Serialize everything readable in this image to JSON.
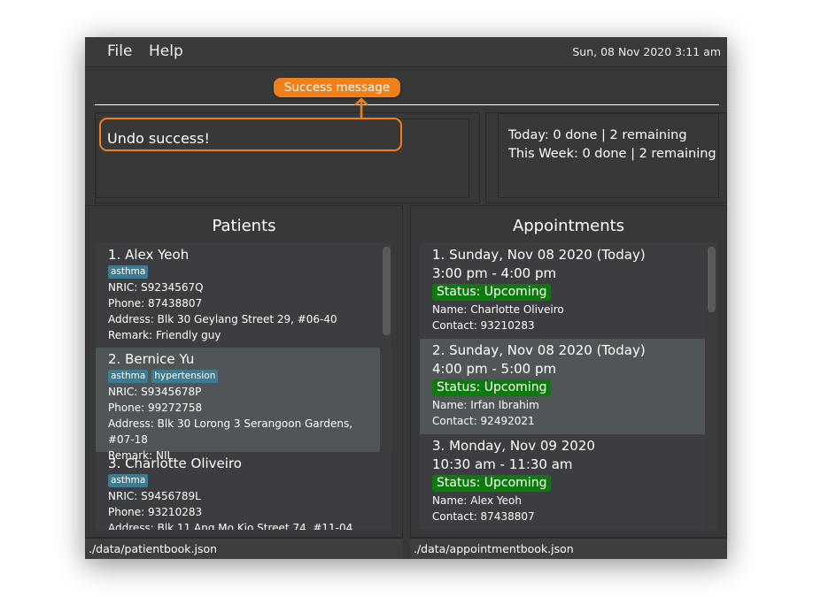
{
  "menu": {
    "file": "File",
    "help": "Help",
    "clock": "Sun, 08 Nov 2020 3:11 am"
  },
  "result": {
    "message": "Undo success!"
  },
  "stats": {
    "today": "Today: 0 done | 2 remaining",
    "week": "This Week: 0 done | 2 remaining"
  },
  "annotation": {
    "label": "Success message",
    "color": "#f0801a"
  },
  "patients": {
    "title": "Patients",
    "status_path": "./data/patientbook.json",
    "items": [
      {
        "name": "1.  Alex Yeoh",
        "tags": [
          "asthma"
        ],
        "nric": "NRIC: S9234567Q",
        "phone": "Phone: 87438807",
        "address": "Address: Blk 30 Geylang Street 29, #06-40",
        "remark": "Remark: Friendly guy"
      },
      {
        "name": "2.  Bernice Yu",
        "tags": [
          "asthma",
          "hypertension"
        ],
        "nric": "NRIC: S9345678P",
        "phone": "Phone: 99272758",
        "address": "Address: Blk 30 Lorong 3 Serangoon Gardens, #07-18",
        "remark": "Remark: NIL"
      },
      {
        "name": "3.  Charlotte Oliveiro",
        "tags": [
          "asthma"
        ],
        "nric": "NRIC: S9456789L",
        "phone": "Phone: 93210283",
        "address": "Address: Blk 11 Ang Mo Kio Street 74, #11-04"
      }
    ]
  },
  "appointments": {
    "title": "Appointments",
    "status_path": "./data/appointmentbook.json",
    "items": [
      {
        "date": "1.  Sunday, Nov 08 2020 (Today)",
        "time": "3:00 pm - 4:00 pm",
        "status": "Status: Upcoming",
        "name": "Name: Charlotte Oliveiro",
        "contact": "Contact: 93210283"
      },
      {
        "date": "2.  Sunday, Nov 08 2020 (Today)",
        "time": "4:00 pm - 5:00 pm",
        "status": "Status: Upcoming",
        "name": "Name: Irfan Ibrahim",
        "contact": "Contact: 92492021"
      },
      {
        "date": "3.  Monday, Nov 09 2020",
        "time": "10:30 am - 11:30 am",
        "status": "Status: Upcoming",
        "name": "Name: Alex Yeoh",
        "contact": "Contact: 87438807"
      }
    ]
  }
}
